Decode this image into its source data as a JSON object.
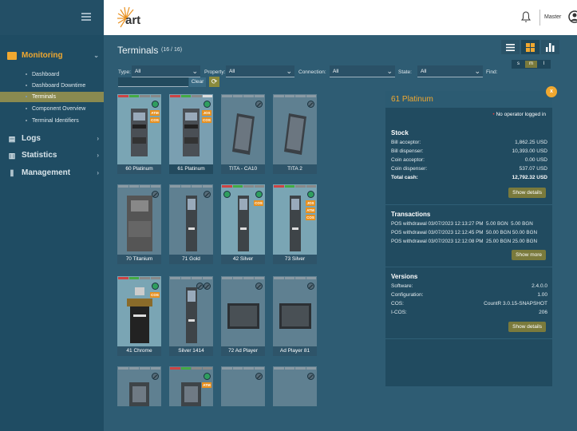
{
  "app": {
    "user": "Master"
  },
  "sidebar": {
    "groups": [
      {
        "label": "Monitoring",
        "icon": "monitor-icon",
        "expanded": true
      },
      {
        "label": "Logs",
        "icon": "file-icon"
      },
      {
        "label": "Statistics",
        "icon": "bar-chart-icon"
      },
      {
        "label": "Management",
        "icon": "sliders-icon"
      }
    ],
    "monitoring_items": [
      "Dashboard",
      "Dashboard Downtime",
      "Terminals",
      "Component Overview",
      "Terminal Identifiers"
    ],
    "active_item": "Terminals"
  },
  "page": {
    "title": "Terminals",
    "count": "(16 / 16)"
  },
  "filters": {
    "type_label": "Type:",
    "type_value": "All",
    "property_label": "Property:",
    "property_value": "All",
    "connection_label": "Connection:",
    "connection_value": "All",
    "state_label": "State:",
    "state_value": "All",
    "find_label": "Find:",
    "clear_label": "Clear"
  },
  "sizes": [
    "s",
    "m",
    "l"
  ],
  "active_size": "m",
  "terminals": [
    {
      "name": "60 Platinum",
      "badges": [
        "ATM",
        "COS"
      ]
    },
    {
      "name": "61 Platinum",
      "badges": [
        "JOS",
        "COS"
      ],
      "selected": true
    },
    {
      "name": "TITA - CA10",
      "badges": []
    },
    {
      "name": "TITA 2",
      "badges": []
    },
    {
      "name": "70 Titanium",
      "badges": []
    },
    {
      "name": "71 Gold",
      "badges": []
    },
    {
      "name": "42 Silver",
      "badges": [
        "COS"
      ]
    },
    {
      "name": "73 Silver",
      "badges": [
        "JOS",
        "ATM",
        "COS"
      ]
    },
    {
      "name": "41 Chrome",
      "badges": [
        "COS"
      ]
    },
    {
      "name": "Silver 1414",
      "badges": []
    },
    {
      "name": "72 Ad Player",
      "badges": []
    },
    {
      "name": "Ad Player 81",
      "badges": []
    },
    {
      "name": "",
      "badges": []
    },
    {
      "name": "",
      "badges": [
        "ATM"
      ]
    },
    {
      "name": "",
      "badges": []
    },
    {
      "name": "",
      "badges": []
    }
  ],
  "panel": {
    "title": "61 Platinum",
    "close": "x",
    "operator": "No operator logged in",
    "stock": {
      "title": "Stock",
      "rows": [
        {
          "label": "Bill acceptor:",
          "value": "1,862.25 USD"
        },
        {
          "label": "Bill dispenser:",
          "value": "10,393.00 USD"
        },
        {
          "label": "Coin acceptor:",
          "value": "0.00 USD"
        },
        {
          "label": "Coin dispenser:",
          "value": "537.07 USD"
        },
        {
          "label": "Total cash:",
          "value": "12,792.32 USD"
        }
      ],
      "button": "Show details"
    },
    "transactions": {
      "title": "Transactions",
      "rows": [
        {
          "text": "POS withdrawal 03/07/2023 12:13:27 PM",
          "v1": "5.00 BGN",
          "v2": "5.00 BGN"
        },
        {
          "text": "POS withdrawal 03/07/2023 12:12:45 PM",
          "v1": "50.00 BGN",
          "v2": "50.00 BGN"
        },
        {
          "text": "POS withdrawal 03/07/2023 12:12:08 PM",
          "v1": "25.00 BGN",
          "v2": "25.00 BGN"
        }
      ],
      "button": "Show more"
    },
    "versions": {
      "title": "Versions",
      "rows": [
        {
          "label": "Software:",
          "value": "2.4.0.0"
        },
        {
          "label": "Configuration:",
          "value": "1.00"
        },
        {
          "label": "COS:",
          "value": "CountR 3.0.15-SNAPSHOT"
        },
        {
          "label": "I-COS:",
          "value": "206"
        }
      ],
      "button": "Show details"
    }
  },
  "colors": {
    "accent": "#f0a830",
    "sidebar": "#1f4c63",
    "main": "#2e5c73",
    "ok": "#2f9e5f"
  }
}
